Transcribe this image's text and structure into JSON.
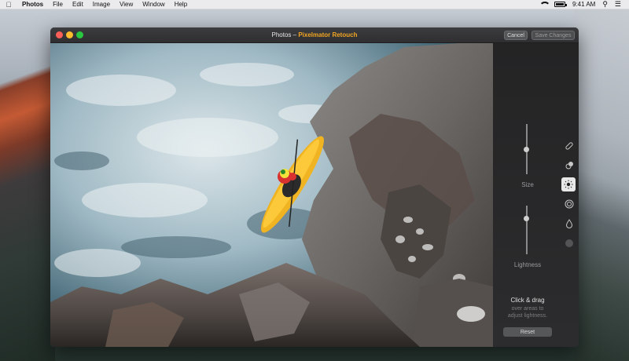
{
  "menubar": {
    "apple": "",
    "app": "Photos",
    "items": [
      "File",
      "Edit",
      "Image",
      "View",
      "Window",
      "Help"
    ],
    "time": "9:41 AM"
  },
  "window": {
    "title_app": "Photos",
    "title_sep": " – ",
    "title_ext": "Pixelmator Retouch",
    "cancel_label": "Cancel",
    "save_label": "Save Changes"
  },
  "sidebar": {
    "size_label": "Size",
    "size_value": 0.5,
    "lightness_label": "Lightness",
    "lightness_value": 0.75,
    "tools": [
      "bandage-icon",
      "clone-icon",
      "sun-icon",
      "target-icon",
      "drop-icon",
      "circle-icon"
    ],
    "active_tool": "sun-icon",
    "hint_title": "Click & drag",
    "hint_line1": "over areas to",
    "hint_line2": "adjust lightness.",
    "reset_label": "Reset"
  }
}
